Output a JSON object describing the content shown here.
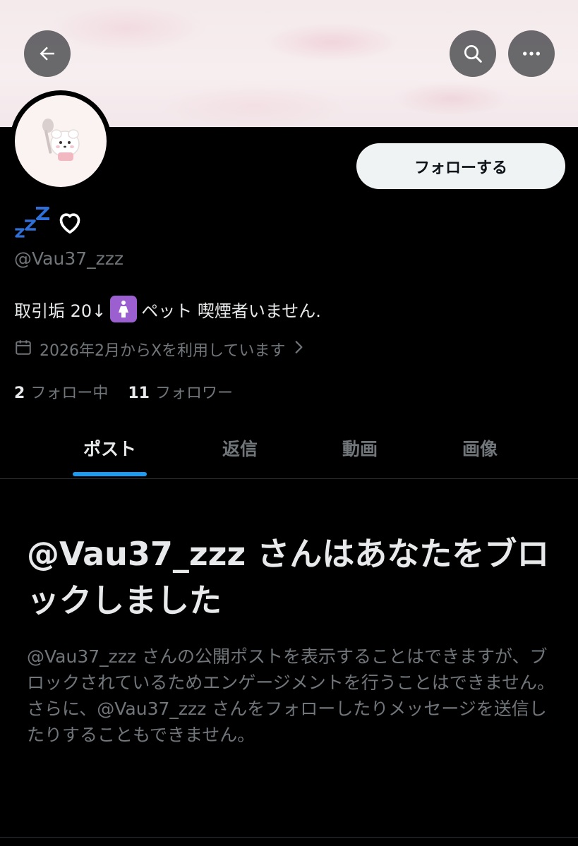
{
  "header": {
    "back_icon": "arrow-left-icon",
    "search_icon": "search-icon",
    "more_icon": "more-horizontal-icon"
  },
  "profile": {
    "avatar_icon": "fluffy-dog-with-spoon-avatar",
    "name_emoji": "💤",
    "name_heart": "♡",
    "handle": "@Vau37_zzz",
    "bio_prefix": "取引垢 20↓",
    "bio_emoji": "🚺",
    "bio_suffix": "ペット 喫煙者いません.",
    "joined": "2026年2月からXを利用しています",
    "follow_button": "フォローする",
    "following_count": "2",
    "following_label": "フォロー中",
    "followers_count": "11",
    "followers_label": "フォロワー"
  },
  "tabs": [
    {
      "label": "ポスト",
      "active": true
    },
    {
      "label": "返信",
      "active": false
    },
    {
      "label": "動画",
      "active": false
    },
    {
      "label": "画像",
      "active": false
    }
  ],
  "blocked": {
    "title": "@Vau37_zzz さんはあなたをブロックしました",
    "body": "@Vau37_zzz さんの公開ポストを表示することはできますが、ブロックされているためエンゲージメントを行うことはできません。さらに、@Vau37_zzz さんをフォローしたりメッセージを送信したりすることもできません。"
  },
  "colors": {
    "background": "#000000",
    "accent": "#1d9bf0",
    "muted_text": "#71767b",
    "primary_text": "#e7e9ea",
    "follow_button_bg": "#eff3f4"
  }
}
